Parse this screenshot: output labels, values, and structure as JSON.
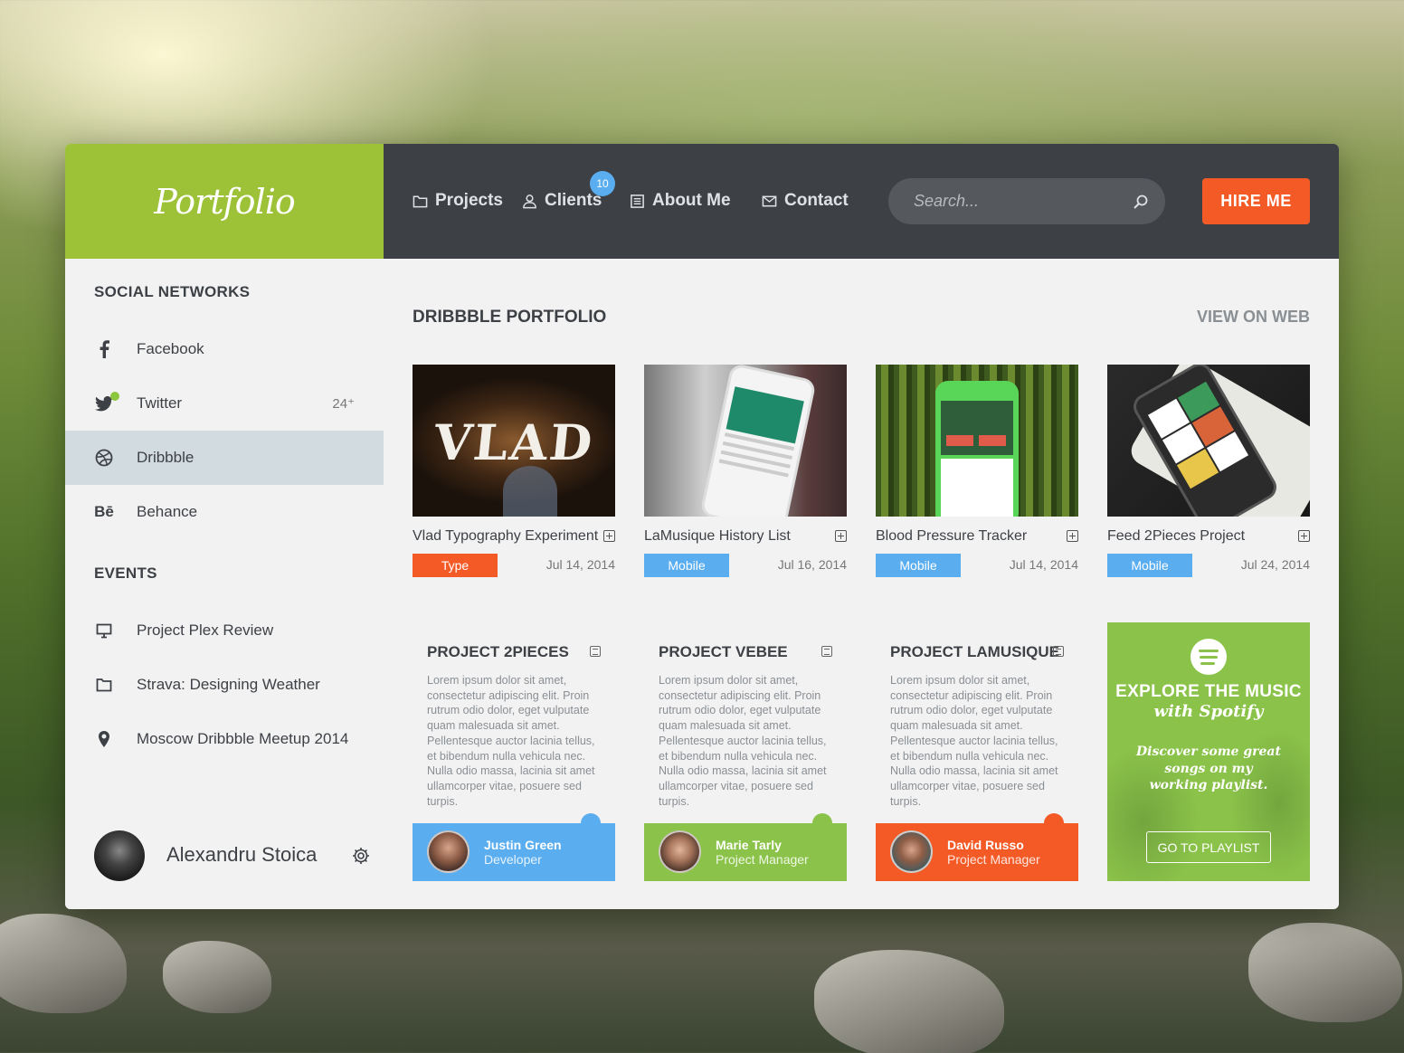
{
  "brand": {
    "logo": "Portfolio"
  },
  "nav": {
    "items": [
      {
        "label": "Projects"
      },
      {
        "label": "Clients",
        "badge": "10"
      },
      {
        "label": "About Me"
      },
      {
        "label": "Contact"
      }
    ],
    "search_placeholder": "Search...",
    "hire_label": "HIRE ME"
  },
  "sidebar": {
    "social_title": "SOCIAL NETWORKS",
    "social": [
      {
        "label": "Facebook",
        "icon": "facebook-icon"
      },
      {
        "label": "Twitter",
        "icon": "twitter-icon",
        "count": "24⁺"
      },
      {
        "label": "Dribbble",
        "icon": "dribbble-icon",
        "active": true
      },
      {
        "label": "Behance",
        "icon": "behance-icon"
      }
    ],
    "events_title": "EVENTS",
    "events": [
      {
        "label": "Project Plex Review",
        "icon": "monitor-icon"
      },
      {
        "label": "Strava: Designing Weather",
        "icon": "folder-icon"
      },
      {
        "label": "Moscow Dribbble Meetup 2014",
        "icon": "location-pin-icon"
      }
    ],
    "profile": {
      "name": "Alexandru Stoica"
    }
  },
  "main": {
    "title": "DRIBBBLE PORTFOLIO",
    "view_on_web": "VIEW ON WEB",
    "shots": [
      {
        "title": "Vlad Typography Experiment",
        "tag": "Type",
        "tag_color": "#f45a26",
        "date": "Jul 14, 2014",
        "thumb_text": "VLAD"
      },
      {
        "title": "LaMusique History List",
        "tag": "Mobile",
        "tag_color": "#5aaef0",
        "date": "Jul 16, 2014"
      },
      {
        "title": "Blood Pressure Tracker",
        "tag": "Mobile",
        "tag_color": "#5aaef0",
        "date": "Jul 14, 2014"
      },
      {
        "title": "Feed 2Pieces Project",
        "tag": "Mobile",
        "tag_color": "#5aaef0",
        "date": "Jul 24, 2014"
      }
    ],
    "projects": [
      {
        "title": "PROJECT 2PIECES",
        "body": "Lorem ipsum dolor sit amet, consectetur adipiscing elit. Proin rutrum odio dolor, eget vulputate quam malesuada sit amet. Pellentesque auctor lacinia tellus, et bibendum nulla vehicula nec. Nulla odio massa, lacinia sit amet ullamcorper vitae, posuere sed turpis.",
        "person_name": "Justin Green",
        "person_role": "Developer",
        "color": "#5aaef0"
      },
      {
        "title": "PROJECT VEBEE",
        "body": "Lorem ipsum dolor sit amet, consectetur adipiscing elit. Proin rutrum odio dolor, eget vulputate quam malesuada sit amet. Pellentesque auctor lacinia tellus, et bibendum nulla vehicula nec. Nulla odio massa, lacinia sit amet ullamcorper vitae, posuere sed turpis.",
        "person_name": "Marie Tarly",
        "person_role": "Project Manager",
        "color": "#8bc34a"
      },
      {
        "title": "PROJECT LAMUSIQUE",
        "body": "Lorem ipsum dolor sit amet, consectetur adipiscing elit. Proin rutrum odio dolor, eget vulputate quam malesuada sit amet. Pellentesque auctor lacinia tellus, et bibendum nulla vehicula nec. Nulla odio massa, lacinia sit amet ullamcorper vitae, posuere sed turpis.",
        "person_name": "David Russo",
        "person_role": "Project Manager",
        "color": "#f45a26"
      }
    ],
    "spotify": {
      "heading": "EXPLORE THE MUSIC",
      "subheading": "with Spotify",
      "body": "Discover some great songs on my working playlist.",
      "button": "GO TO PLAYLIST"
    }
  },
  "colors": {
    "accent_green": "#9dc238",
    "topbar": "#3d4146",
    "hire_orange": "#f45a26",
    "blue": "#5aaef0"
  }
}
